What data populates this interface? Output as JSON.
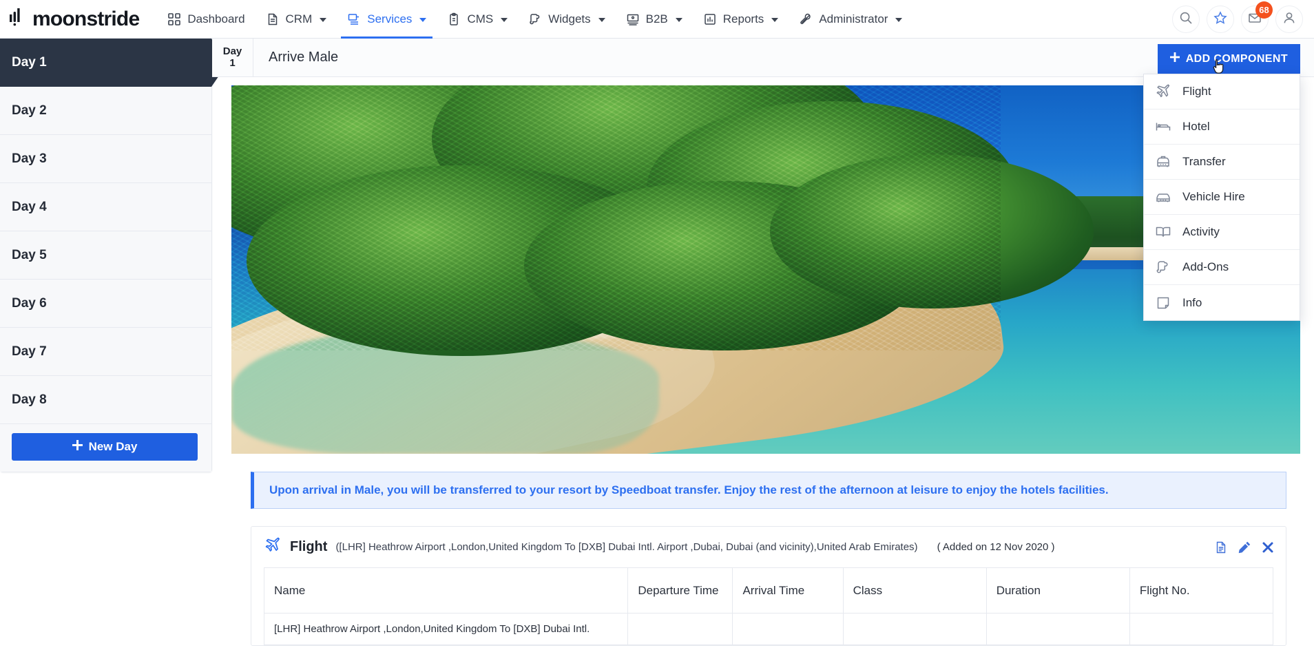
{
  "brand": {
    "name": "moonstride",
    "logo_icon": "bars-logo-icon"
  },
  "topnav": {
    "items": [
      {
        "label": "Dashboard",
        "icon": "grid-icon",
        "has_caret": false,
        "active": false
      },
      {
        "label": "CRM",
        "icon": "document-icon",
        "has_caret": true,
        "active": false
      },
      {
        "label": "Services",
        "icon": "services-screen-icon",
        "has_caret": true,
        "active": true
      },
      {
        "label": "CMS",
        "icon": "clipboard-icon",
        "has_caret": true,
        "active": false
      },
      {
        "label": "Widgets",
        "icon": "puzzle-icon",
        "has_caret": true,
        "active": false
      },
      {
        "label": "B2B",
        "icon": "monitor-icon",
        "has_caret": true,
        "active": false
      },
      {
        "label": "Reports",
        "icon": "bar-chart-icon",
        "has_caret": true,
        "active": false
      },
      {
        "label": "Administrator",
        "icon": "wrench-icon",
        "has_caret": true,
        "active": false
      }
    ],
    "actions": [
      {
        "name": "search-icon"
      },
      {
        "name": "star-icon"
      },
      {
        "name": "mail-icon",
        "badge": "68"
      },
      {
        "name": "user-avatar-icon"
      }
    ]
  },
  "sidebar": {
    "days": [
      {
        "label": "Day 1",
        "selected": true
      },
      {
        "label": "Day 2",
        "selected": false
      },
      {
        "label": "Day 3",
        "selected": false
      },
      {
        "label": "Day 4",
        "selected": false
      },
      {
        "label": "Day 5",
        "selected": false
      },
      {
        "label": "Day 6",
        "selected": false
      },
      {
        "label": "Day 7",
        "selected": false
      },
      {
        "label": "Day 8",
        "selected": false
      }
    ],
    "new_day_label": "New Day"
  },
  "daybar": {
    "day_word": "Day",
    "day_number": "1",
    "title": "Arrive Male",
    "add_component_label": "ADD COMPONENT"
  },
  "dropdown": {
    "items": [
      {
        "label": "Flight",
        "icon": "plane-icon"
      },
      {
        "label": "Hotel",
        "icon": "bed-icon"
      },
      {
        "label": "Transfer",
        "icon": "taxi-icon"
      },
      {
        "label": "Vehicle Hire",
        "icon": "car-icon"
      },
      {
        "label": "Activity",
        "icon": "book-icon"
      },
      {
        "label": "Add-Ons",
        "icon": "puzzle-piece-icon"
      },
      {
        "label": "Info",
        "icon": "note-icon"
      }
    ]
  },
  "hero": {
    "alt": "tropical-beach-photo"
  },
  "note": {
    "text": "Upon arrival in Male, you will be transferred to your resort by Speedboat transfer. Enjoy the rest of the afternoon at leisure to enjoy the hotels facilities."
  },
  "component": {
    "type": "Flight",
    "description": "([LHR] Heathrow Airport ,London,United Kingdom To [DXB] Dubai Intl. Airport ,Dubai, Dubai (and vicinity),United Arab Emirates)",
    "added": "( Added on 12 Nov 2020 )",
    "actions": [
      {
        "name": "document-icon"
      },
      {
        "name": "edit-pencil-icon"
      },
      {
        "name": "delete-close-icon"
      }
    ],
    "table": {
      "columns": [
        "Name",
        "Departure Time",
        "Arrival Time",
        "Class",
        "Duration",
        "Flight No."
      ],
      "rows": [
        {
          "name": "[LHR] Heathrow Airport ,London,United Kingdom To [DXB] Dubai Intl.",
          "departure_time": "",
          "arrival_time": "",
          "class": "",
          "duration": "",
          "flight_no": ""
        }
      ]
    }
  },
  "colors": {
    "accent_blue": "#1f5fe0",
    "link_blue": "#2d6ff0",
    "sidebar_selected": "#2b3545",
    "badge_orange": "#f4511e",
    "note_bg": "#eaf1fe"
  }
}
